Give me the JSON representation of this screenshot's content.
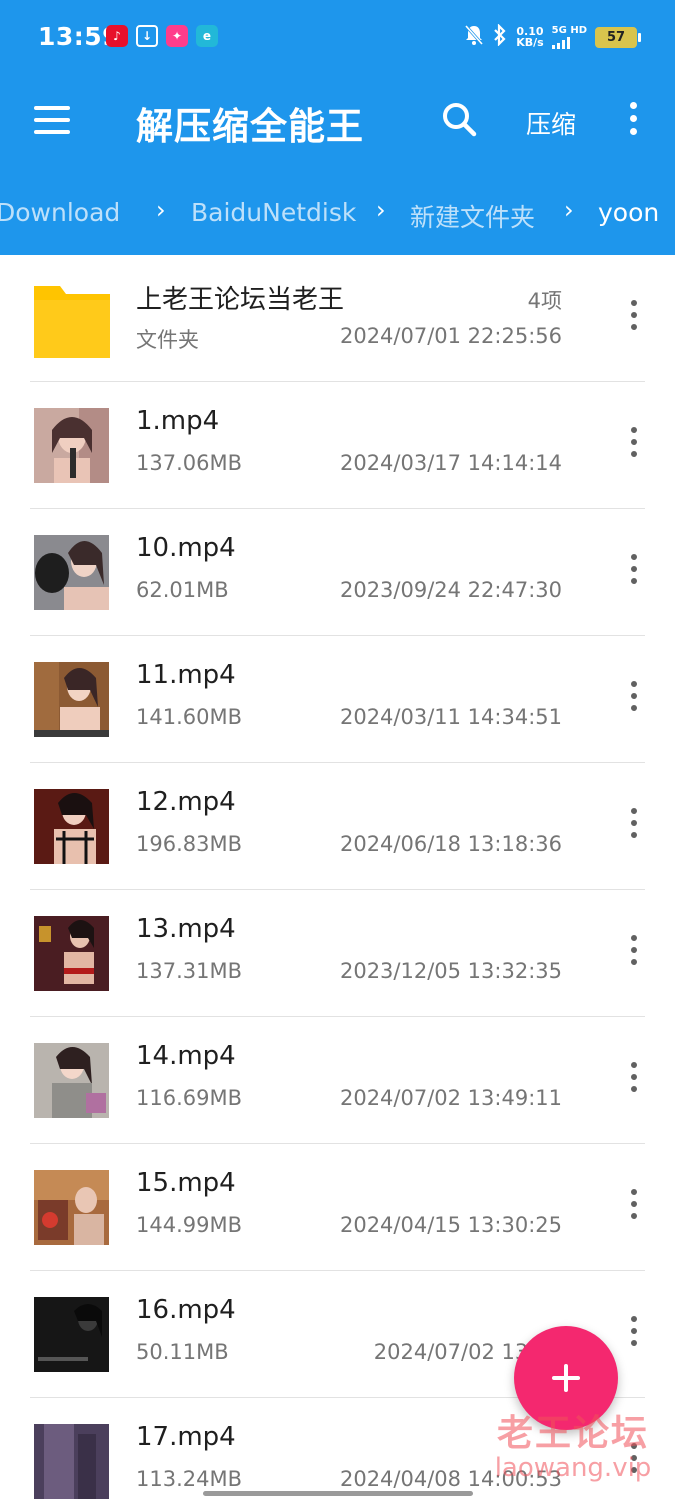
{
  "status_bar": {
    "time": "13:59",
    "net_speed_value": "0.10",
    "net_speed_unit": "KB/s",
    "network_type": "5G HD",
    "battery": "57",
    "notification_icons": [
      "netease-music-icon",
      "download-icon",
      "pink-app-icon",
      "cyan-app-icon"
    ]
  },
  "toolbar": {
    "title": "解压缩全能王",
    "compress_label": "压缩"
  },
  "breadcrumb": [
    "Download",
    "BaiduNetdisk",
    "新建文件夹",
    "yoon"
  ],
  "files": [
    {
      "name": "上老王论坛当老王",
      "meta": "文件夹",
      "count": "4项",
      "date": "2024/07/01 22:25:56",
      "type": "folder"
    },
    {
      "name": "1.mp4",
      "meta": "137.06MB",
      "date": "2024/03/17 14:14:14",
      "type": "video"
    },
    {
      "name": "10.mp4",
      "meta": "62.01MB",
      "date": "2023/09/24 22:47:30",
      "type": "video"
    },
    {
      "name": "11.mp4",
      "meta": "141.60MB",
      "date": "2024/03/11 14:34:51",
      "type": "video"
    },
    {
      "name": "12.mp4",
      "meta": "196.83MB",
      "date": "2024/06/18 13:18:36",
      "type": "video"
    },
    {
      "name": "13.mp4",
      "meta": "137.31MB",
      "date": "2023/12/05 13:32:35",
      "type": "video"
    },
    {
      "name": "14.mp4",
      "meta": "116.69MB",
      "date": "2024/07/02 13:49:11",
      "type": "video"
    },
    {
      "name": "15.mp4",
      "meta": "144.99MB",
      "date": "2024/04/15 13:30:25",
      "type": "video"
    },
    {
      "name": "16.mp4",
      "meta": "50.11MB",
      "date": "2024/07/02 13:48",
      "type": "video"
    },
    {
      "name": "17.mp4",
      "meta": "113.24MB",
      "date": "2024/04/08 14:00:53",
      "type": "video"
    }
  ],
  "watermark": {
    "text": "老王论坛",
    "url": "laowang.vip"
  },
  "colors": {
    "header": "#1e96ec",
    "fab": "#f4286f",
    "folder": "#ffc400"
  }
}
